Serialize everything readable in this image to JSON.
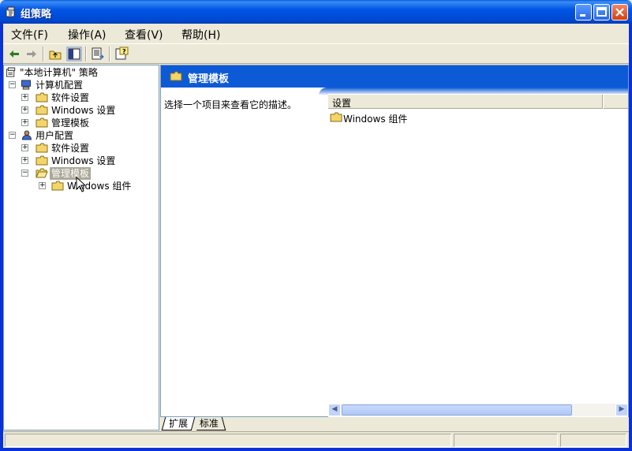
{
  "window": {
    "title": "组策略",
    "buttons": [
      "minimize",
      "maximize",
      "close"
    ]
  },
  "menu": {
    "items": [
      "文件(F)",
      "操作(A)",
      "查看(V)",
      "帮助(H)"
    ]
  },
  "toolbar": {
    "icons": [
      "back-arrow-icon",
      "forward-arrow-icon",
      "up-folder-icon",
      "show-hide-tree-icon",
      "export-list-icon",
      "help-icon"
    ]
  },
  "tree": {
    "root": "\"本地计算机\" 策略",
    "computer_config": "计算机配置",
    "cc_software": "软件设置",
    "cc_windows": "Windows 设置",
    "cc_admin": "管理模板",
    "user_config": "用户配置",
    "uc_software": "软件设置",
    "uc_windows": "Windows 设置",
    "uc_admin": "管理模板",
    "uc_admin_windows_components": "Windows 组件"
  },
  "detail": {
    "header_title": "管理模板",
    "description": "选择一个项目来查看它的描述。",
    "column_header": "设置",
    "items": [
      "Windows 组件"
    ]
  },
  "tabs": {
    "extended": "扩展",
    "standard": "标准"
  },
  "colors": {
    "header_blue": "#0d5ad6",
    "selection_gray": "#aca899",
    "window_face": "#ece9d8"
  }
}
